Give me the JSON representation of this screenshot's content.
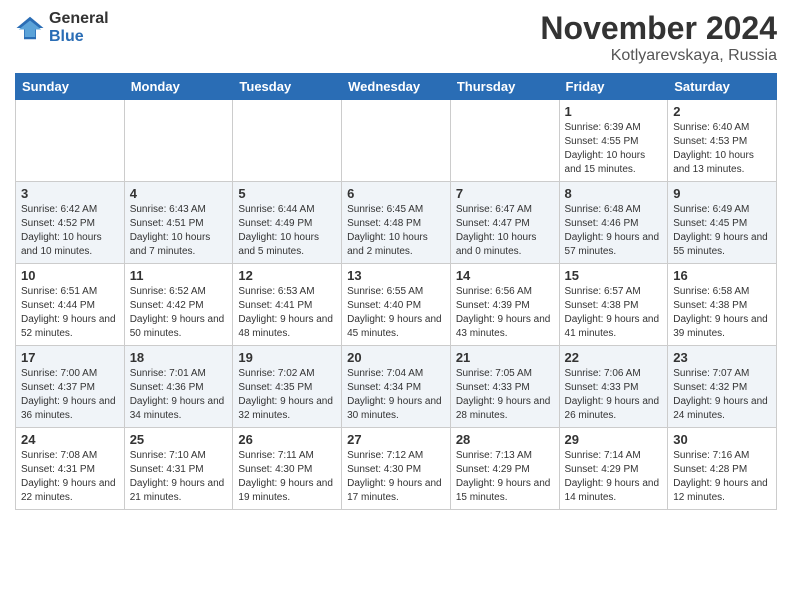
{
  "logo": {
    "general": "General",
    "blue": "Blue"
  },
  "title": "November 2024",
  "location": "Kotlyarevskaya, Russia",
  "days_of_week": [
    "Sunday",
    "Monday",
    "Tuesday",
    "Wednesday",
    "Thursday",
    "Friday",
    "Saturday"
  ],
  "weeks": [
    [
      {
        "day": "",
        "info": ""
      },
      {
        "day": "",
        "info": ""
      },
      {
        "day": "",
        "info": ""
      },
      {
        "day": "",
        "info": ""
      },
      {
        "day": "",
        "info": ""
      },
      {
        "day": "1",
        "info": "Sunrise: 6:39 AM\nSunset: 4:55 PM\nDaylight: 10 hours and 15 minutes."
      },
      {
        "day": "2",
        "info": "Sunrise: 6:40 AM\nSunset: 4:53 PM\nDaylight: 10 hours and 13 minutes."
      }
    ],
    [
      {
        "day": "3",
        "info": "Sunrise: 6:42 AM\nSunset: 4:52 PM\nDaylight: 10 hours and 10 minutes."
      },
      {
        "day": "4",
        "info": "Sunrise: 6:43 AM\nSunset: 4:51 PM\nDaylight: 10 hours and 7 minutes."
      },
      {
        "day": "5",
        "info": "Sunrise: 6:44 AM\nSunset: 4:49 PM\nDaylight: 10 hours and 5 minutes."
      },
      {
        "day": "6",
        "info": "Sunrise: 6:45 AM\nSunset: 4:48 PM\nDaylight: 10 hours and 2 minutes."
      },
      {
        "day": "7",
        "info": "Sunrise: 6:47 AM\nSunset: 4:47 PM\nDaylight: 10 hours and 0 minutes."
      },
      {
        "day": "8",
        "info": "Sunrise: 6:48 AM\nSunset: 4:46 PM\nDaylight: 9 hours and 57 minutes."
      },
      {
        "day": "9",
        "info": "Sunrise: 6:49 AM\nSunset: 4:45 PM\nDaylight: 9 hours and 55 minutes."
      }
    ],
    [
      {
        "day": "10",
        "info": "Sunrise: 6:51 AM\nSunset: 4:44 PM\nDaylight: 9 hours and 52 minutes."
      },
      {
        "day": "11",
        "info": "Sunrise: 6:52 AM\nSunset: 4:42 PM\nDaylight: 9 hours and 50 minutes."
      },
      {
        "day": "12",
        "info": "Sunrise: 6:53 AM\nSunset: 4:41 PM\nDaylight: 9 hours and 48 minutes."
      },
      {
        "day": "13",
        "info": "Sunrise: 6:55 AM\nSunset: 4:40 PM\nDaylight: 9 hours and 45 minutes."
      },
      {
        "day": "14",
        "info": "Sunrise: 6:56 AM\nSunset: 4:39 PM\nDaylight: 9 hours and 43 minutes."
      },
      {
        "day": "15",
        "info": "Sunrise: 6:57 AM\nSunset: 4:38 PM\nDaylight: 9 hours and 41 minutes."
      },
      {
        "day": "16",
        "info": "Sunrise: 6:58 AM\nSunset: 4:38 PM\nDaylight: 9 hours and 39 minutes."
      }
    ],
    [
      {
        "day": "17",
        "info": "Sunrise: 7:00 AM\nSunset: 4:37 PM\nDaylight: 9 hours and 36 minutes."
      },
      {
        "day": "18",
        "info": "Sunrise: 7:01 AM\nSunset: 4:36 PM\nDaylight: 9 hours and 34 minutes."
      },
      {
        "day": "19",
        "info": "Sunrise: 7:02 AM\nSunset: 4:35 PM\nDaylight: 9 hours and 32 minutes."
      },
      {
        "day": "20",
        "info": "Sunrise: 7:04 AM\nSunset: 4:34 PM\nDaylight: 9 hours and 30 minutes."
      },
      {
        "day": "21",
        "info": "Sunrise: 7:05 AM\nSunset: 4:33 PM\nDaylight: 9 hours and 28 minutes."
      },
      {
        "day": "22",
        "info": "Sunrise: 7:06 AM\nSunset: 4:33 PM\nDaylight: 9 hours and 26 minutes."
      },
      {
        "day": "23",
        "info": "Sunrise: 7:07 AM\nSunset: 4:32 PM\nDaylight: 9 hours and 24 minutes."
      }
    ],
    [
      {
        "day": "24",
        "info": "Sunrise: 7:08 AM\nSunset: 4:31 PM\nDaylight: 9 hours and 22 minutes."
      },
      {
        "day": "25",
        "info": "Sunrise: 7:10 AM\nSunset: 4:31 PM\nDaylight: 9 hours and 21 minutes."
      },
      {
        "day": "26",
        "info": "Sunrise: 7:11 AM\nSunset: 4:30 PM\nDaylight: 9 hours and 19 minutes."
      },
      {
        "day": "27",
        "info": "Sunrise: 7:12 AM\nSunset: 4:30 PM\nDaylight: 9 hours and 17 minutes."
      },
      {
        "day": "28",
        "info": "Sunrise: 7:13 AM\nSunset: 4:29 PM\nDaylight: 9 hours and 15 minutes."
      },
      {
        "day": "29",
        "info": "Sunrise: 7:14 AM\nSunset: 4:29 PM\nDaylight: 9 hours and 14 minutes."
      },
      {
        "day": "30",
        "info": "Sunrise: 7:16 AM\nSunset: 4:28 PM\nDaylight: 9 hours and 12 minutes."
      }
    ]
  ]
}
